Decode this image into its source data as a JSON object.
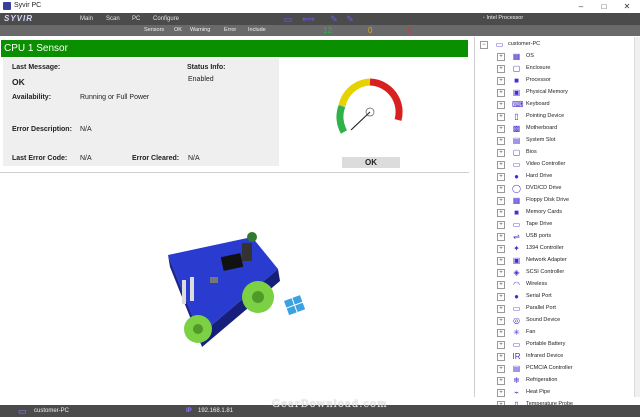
{
  "window": {
    "title": "Syvir PC",
    "minimize": "–",
    "maximize": "□",
    "close": "✕"
  },
  "logo": "SYVIR",
  "menu": [
    "Main",
    "Scan",
    "PC",
    "Configure"
  ],
  "toolbar_icons": [
    "monitor-icon",
    "arrows-icon",
    "wrench-icon",
    "tools-icon"
  ],
  "processor_selector": "Intel Processor",
  "sensorbar": {
    "items": [
      "Sensors",
      "OK",
      "Warning",
      "Error",
      "Include"
    ],
    "counts": {
      "ok": "12",
      "warning": "0",
      "error": "0"
    },
    "count_colors": {
      "ok": "#2fb24a",
      "warning": "#e0b000",
      "error": "#e03030"
    }
  },
  "sensor": {
    "title": "CPU 1 Sensor",
    "header_color": "#0a8f00",
    "last_message_label": "Last Message:",
    "last_message": "OK",
    "status_info_label": "Status Info:",
    "status_info": "Enabled",
    "availability_label": "Availability:",
    "availability": "Running or Full Power",
    "error_description_label": "Error Description:",
    "error_description": "N/A",
    "last_error_code_label": "Last Error Code:",
    "last_error_code": "N/A",
    "error_cleared_label": "Error Cleared:",
    "error_cleared": "N/A",
    "gauge_status": "OK"
  },
  "tree": {
    "root": "customer-PC",
    "items": [
      {
        "label": "OS",
        "icon": "windows-icon",
        "glyph": "▦"
      },
      {
        "label": "Enclosure",
        "icon": "enclosure-icon",
        "glyph": "▢"
      },
      {
        "label": "Processor",
        "icon": "processor-icon",
        "glyph": "■"
      },
      {
        "label": "Physical Memory",
        "icon": "memory-icon",
        "glyph": "▣"
      },
      {
        "label": "Keyboard",
        "icon": "keyboard-icon",
        "glyph": "⌨"
      },
      {
        "label": "Pointing Device",
        "icon": "mouse-icon",
        "glyph": "▯"
      },
      {
        "label": "Motherboard",
        "icon": "motherboard-icon",
        "glyph": "▩"
      },
      {
        "label": "System Slot",
        "icon": "slot-icon",
        "glyph": "▤"
      },
      {
        "label": "Bios",
        "icon": "bios-icon",
        "glyph": "▢"
      },
      {
        "label": "Video Controller",
        "icon": "video-icon",
        "glyph": "▭"
      },
      {
        "label": "Hard Drive",
        "icon": "harddrive-icon",
        "glyph": "●"
      },
      {
        "label": "DVD/CD Drive",
        "icon": "disc-icon",
        "glyph": "◯"
      },
      {
        "label": "Floppy Disk Drive",
        "icon": "floppy-icon",
        "glyph": "▦"
      },
      {
        "label": "Memory Cards",
        "icon": "memorycard-icon",
        "glyph": "■"
      },
      {
        "label": "Tape Drive",
        "icon": "tape-icon",
        "glyph": "▭"
      },
      {
        "label": "USB ports",
        "icon": "usb-icon",
        "glyph": "⇌"
      },
      {
        "label": "1394 Controller",
        "icon": "firewire-icon",
        "glyph": "✦"
      },
      {
        "label": "Network Adapter",
        "icon": "network-icon",
        "glyph": "▣"
      },
      {
        "label": "SCSI Controller",
        "icon": "scsi-icon",
        "glyph": "◈"
      },
      {
        "label": "Wireless",
        "icon": "wireless-icon",
        "glyph": "◠"
      },
      {
        "label": "Serial Port",
        "icon": "serial-port-icon",
        "glyph": "●"
      },
      {
        "label": "Parallel Port",
        "icon": "parallel-port-icon",
        "glyph": "▭"
      },
      {
        "label": "Sound Device",
        "icon": "sound-icon",
        "glyph": "◎"
      },
      {
        "label": "Fan",
        "icon": "fan-icon",
        "glyph": "✳"
      },
      {
        "label": "Portable Battery",
        "icon": "battery-icon",
        "glyph": "▭"
      },
      {
        "label": "Infrared Device",
        "icon": "infrared-icon",
        "glyph": "IR"
      },
      {
        "label": "PCMCIA Controller",
        "icon": "pcmcia-icon",
        "glyph": "▤"
      },
      {
        "label": "Refrigeration",
        "icon": "refrigeration-icon",
        "glyph": "❄"
      },
      {
        "label": "Heat Pipe",
        "icon": "heatpipe-icon",
        "glyph": "⌁"
      },
      {
        "label": "Temperature Probe",
        "icon": "temperature-icon",
        "glyph": "▯"
      }
    ]
  },
  "statusbar": {
    "pc_name": "customer-PC",
    "ip_label": "IP",
    "ip": "192.168.1.81"
  },
  "watermark": "GearDownload.com"
}
